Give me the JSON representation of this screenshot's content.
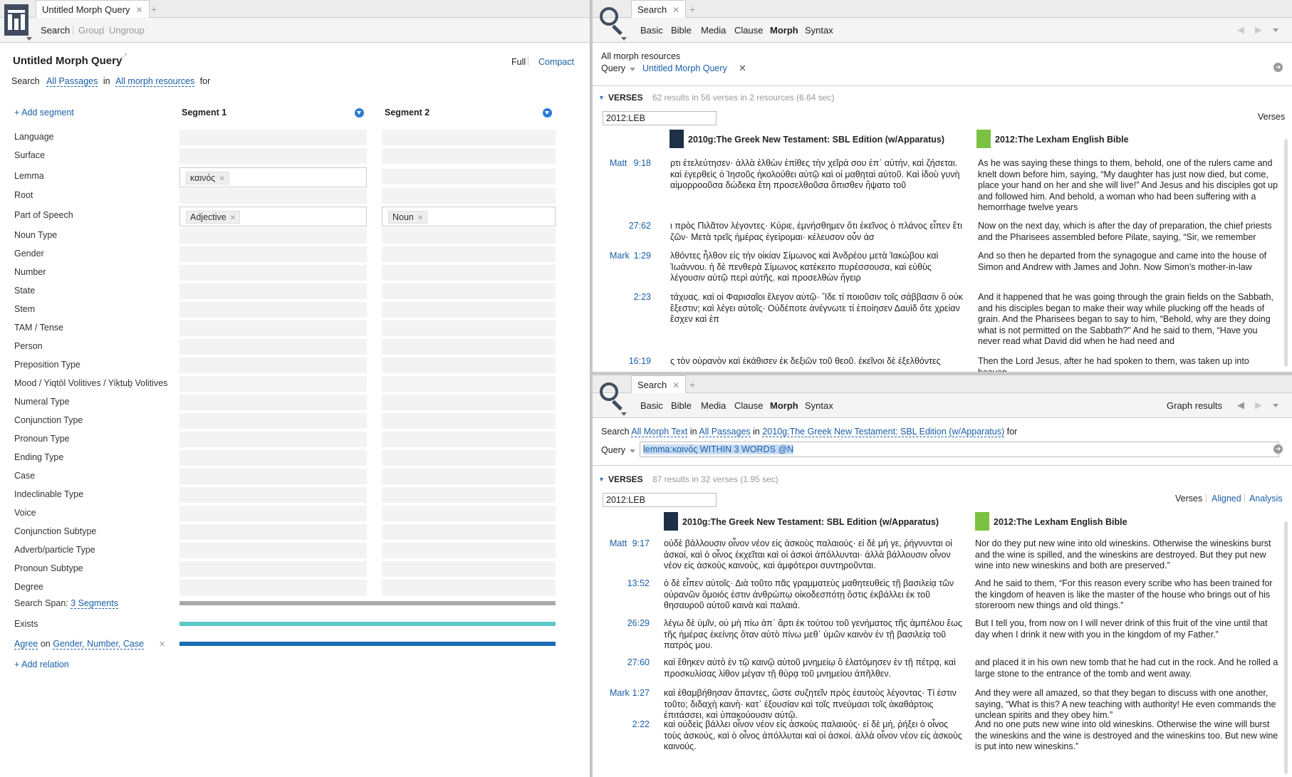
{
  "left": {
    "tab_title": "Untitled Morph Query",
    "toolbar": {
      "search": "Search",
      "group": "Group",
      "ungroup": "Ungroup"
    },
    "query_title": "Untitled Morph Query",
    "view_full": "Full",
    "view_compact": "Compact",
    "search_line": {
      "search": "Search",
      "passages": "All Passages",
      "in": "in",
      "resources": "All morph resources",
      "for": "for"
    },
    "add_segment": "+ Add segment",
    "segment1": "Segment 1",
    "segment2": "Segment 2",
    "rows": [
      "Language",
      "Surface",
      "Lemma",
      "Root",
      "Part of Speech",
      "Noun Type",
      "Gender",
      "Number",
      "State",
      "Stem",
      "TAM / Tense",
      "Person",
      "Preposition Type",
      "Mood / Yiqtōl Volitives / Yiḳtuḇ Volitives",
      "Numeral Type",
      "Conjunction Type",
      "Pronoun Type",
      "Ending Type",
      "Case",
      "Indeclinable Type",
      "Voice",
      "Conjunction Subtype",
      "Adverb/particle Type",
      "Pronoun Subtype",
      "Degree"
    ],
    "lemma_chip": "καινός",
    "pos_chip1": "Adjective",
    "pos_chip2": "Noun",
    "search_span_label": "Search Span:",
    "search_span_value": "3 Segments",
    "exists": "Exists",
    "agree": "Agree",
    "agree_on": "on",
    "agree_fields": "Gender, Number, Case",
    "add_relation": "+ Add relation",
    "colors": {
      "span_bar": "#aaaaaa",
      "exists_bar": "#5cc8c8",
      "agree_bar": "#1a6db5"
    }
  },
  "top": {
    "tab": "Search",
    "nav": [
      "Basic",
      "Bible",
      "Media",
      "Clause",
      "Morph",
      "Syntax"
    ],
    "resources": "All morph resources",
    "query_label": "Query",
    "query_value": "Untitled Morph Query",
    "verses_label": "VERSES",
    "verses_info": "62 results in 56 verses in 2 resources (6.64 sec)",
    "filter": "2012:LEB",
    "right_label": "Verses",
    "col1": "2010g:The Greek New Testament: SBL Edition (w/Apparatus)",
    "col2": "2012:The Lexham English Bible",
    "rows": [
      {
        "book": "Matt",
        "ref": "9:18",
        "greek": "ρτι ἐτελεύτησεν· ἀλλὰ ἐλθὼν ἐπίθες τὴν χεῖρά σου ἐπ᾽ αὐτήν, καὶ ζήσεται. καὶ ἐγερθεὶς ὁ Ἰησοῦς ἠκολούθει αὐτῷ καὶ οἱ μαθηταὶ αὐτοῦ. Καὶ ἰδοὺ γυνὴ αἱμορροοῦσα δώδεκα ἔτη προσελθοῦσα ὄπισθεν ἥψατο τοῦ",
        "eng": "As he was saying these things to them, behold, one of the rulers came and knelt down before him, saying, “My daughter has just now died, but come, place your hand on her and she will live!” And Jesus and his disciples got up and followed him. And behold, a woman who had been suffering with a hemorrhage twelve years"
      },
      {
        "book": "",
        "ref": "27:62",
        "greek": "ι πρὸς Πιλᾶτον λέγοντες· Κύριε, ἐμνήσθημεν ὅτι ἐκεῖνος ὁ πλάνος εἶπεν ἔτι ζῶν· Μετὰ τρεῖς ἡμέρας ἐγείρομαι· κέλευσον οὖν ἀσ",
        "eng": "Now on the next day, which is after the day of preparation, the chief priests and the Pharisees assembled before Pilate, saying, “Sir, we remember"
      },
      {
        "book": "Mark",
        "ref": "1:29",
        "greek": "λθόντες ἦλθον εἰς τὴν οἰκίαν Σίμωνος καὶ Ἀνδρέου μετὰ Ἰακώβου καὶ Ἰωάννου. ἡ δὲ πενθερὰ Σίμωνος κατέκειτο πυρέσσουσα, καὶ εὐθὺς λέγουσιν αὐτῷ περὶ αὐτῆς. καὶ προσελθὼν ἤγειρ",
        "eng": "And so then he departed from the synagogue and came into the house of Simon and Andrew with James and John. Now Simon’s mother-in-law"
      },
      {
        "book": "",
        "ref": "2:23",
        "greek": "τάχυας. καὶ οἱ Φαρισαῖοι ἔλεγον αὐτῷ· Ἴδε τί ποιοῦσιν τοῖς σάββασιν ὃ οὐκ ἔξεστιν; καὶ λέγει αὐτοῖς· Οὐδέποτε ἀνέγνωτε τί ἐποίησεν Δαυὶδ ὅτε χρείαν ἔσχεν καὶ ἐπ",
        "eng": "And it happened that he was going through the grain fields on the Sabbath, and his disciples began to make their way while plucking off the heads of grain. And the Pharisees began to say to him, “Behold, why are they doing what is not permitted on the Sabbath?” And he said to them, “Have you never read what David did when he had need and"
      },
      {
        "book": "",
        "ref": "16:19",
        "greek": "ς τὸν οὐρανὸν καὶ ἐκάθισεν ἐκ δεξιῶν τοῦ θεοῦ. ἐκεῖνοι δὲ ἐξελθόντες",
        "eng": "Then the Lord Jesus, after he had spoken to them, was taken up into heaven"
      }
    ]
  },
  "bottom": {
    "tab": "Search",
    "nav": [
      "Basic",
      "Bible",
      "Media",
      "Clause",
      "Morph",
      "Syntax"
    ],
    "graph": "Graph results",
    "search_line": {
      "search": "Search",
      "text": "All Morph Text",
      "in": "in",
      "passages": "All Passages",
      "in2": "in",
      "resource": "2010g:The Greek New Testament: SBL Edition (w/Apparatus)",
      "for": "for"
    },
    "query_label": "Query",
    "query_value": "lemma:καινός WITHIN 3 WORDS @N",
    "verses_label": "VERSES",
    "verses_info": "87 results in 32 verses (1.95 sec)",
    "filter": "2012:LEB",
    "views": [
      "Verses",
      "Aligned",
      "Analysis"
    ],
    "col1": "2010g:The Greek New Testament: SBL Edition (w/Apparatus)",
    "col2": "2012:The Lexham English Bible",
    "rows": [
      {
        "book": "Matt",
        "ref": "9:17",
        "greek": "οὐδὲ βάλλουσιν οἶνον νέον εἰς ἀσκοὺς παλαιούς· εἰ δὲ μή γε, ῥήγνυνται οἱ ἀσκοί, καὶ ὁ οἶνος ἐκχεῖται καὶ οἱ ἀσκοὶ ἀπόλλυνται· ἀλλὰ βάλλουσιν οἶνον νέον εἰς ἀσκοὺς καινούς, καὶ ἀμφότεροι συντηροῦνται.",
        "eng": "Nor do they put new wine into old wineskins. Otherwise the wineskins burst and the wine is spilled, and the wineskins are destroyed. But they put new wine into new wineskins and both are preserved.”"
      },
      {
        "book": "",
        "ref": "13:52",
        "greek": "ὁ δὲ εἶπεν αὐτοῖς· Διὰ τοῦτο πᾶς γραμματεὺς μαθητευθεὶς τῇ βασιλείᾳ τῶν οὐρανῶν ὅμοιός ἐστιν ἀνθρώπῳ οἰκοδεσπότῃ ὅστις ἐκβάλλει ἐκ τοῦ θησαυροῦ αὐτοῦ καινὰ καὶ παλαιά.",
        "eng": "And he said to them, “For this reason every scribe who has been trained for the kingdom of heaven is like the master of the house who brings out of his storeroom new things and old things.”"
      },
      {
        "book": "",
        "ref": "26:29",
        "greek": "λέγω δὲ ὑμῖν, οὐ μὴ πίω ἀπ᾽ ἄρτι ἐκ τούτου τοῦ γενήματος τῆς ἀμπέλου ἕως τῆς ἡμέρας ἐκείνης ὅταν αὐτὸ πίνω μεθ᾽ ὑμῶν καινὸν ἐν τῇ βασιλείᾳ τοῦ πατρός μου.",
        "eng": "But I tell you, from now on I will never drink of this fruit of the vine until that day when I drink it new with you in the kingdom of my Father.”"
      },
      {
        "book": "",
        "ref": "27:60",
        "greek": "καὶ ἔθηκεν αὐτὸ ἐν τῷ καινῷ αὐτοῦ μνημείῳ ὃ ἐλατόμησεν ἐν τῇ πέτρᾳ, καὶ προσκυλίσας λίθον μέγαν τῇ θύρᾳ τοῦ μνημείου ἀπῆλθεν.",
        "eng": "and placed it in his own new tomb that he had cut in the rock. And he rolled a large stone to the entrance of the tomb and went away."
      },
      {
        "book": "Mark",
        "ref": "1:27",
        "greek": "καὶ ἐθαμβήθησαν ἅπαντες, ὥστε συζητεῖν πρὸς ἑαυτοὺς λέγοντας· Τί ἐστιν τοῦτο; διδαχὴ καινὴ· κατ᾽ ἐξουσίαν καὶ τοῖς πνεύμασι τοῖς ἀκαθάρτοις ἐπιτάσσει, καὶ ὑπακούουσιν αὐτῷ.",
        "eng": "And they were all amazed, so that they began to discuss with one another, saying, “What is this? A new teaching with authority! He even commands the unclean spirits and they obey him.”"
      },
      {
        "book": "",
        "ref": "2:22",
        "greek": "καὶ οὐδεὶς βάλλει οἶνον νέον εἰς ἀσκοὺς παλαιούς· εἰ δὲ μή, ῥήξει ὁ οἶνος τοὺς ἀσκούς, καὶ ὁ οἶνος ἀπόλλυται καὶ οἱ ἀσκοί. ἀλλὰ οἶνον νέον εἰς ἀσκοὺς καινούς.",
        "eng": "And no one puts new wine into old wineskins. Otherwise the wine will burst the wineskins and the wine is destroyed and the wineskins too. But new wine is put into new wineskins.”"
      }
    ]
  }
}
